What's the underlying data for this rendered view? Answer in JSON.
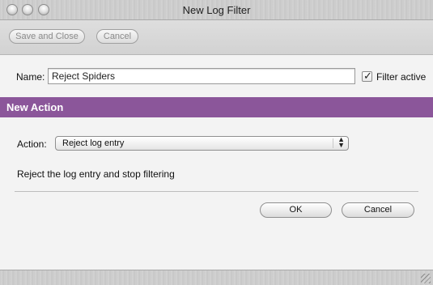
{
  "window": {
    "title": "New Log Filter"
  },
  "toolbar": {
    "save_close_label": "Save and Close",
    "cancel_label": "Cancel"
  },
  "form": {
    "name_label": "Name:",
    "name_value": "Reject Spiders",
    "filter_active_label": "Filter active",
    "filter_active_checked": true
  },
  "section": {
    "title": "New Action"
  },
  "action": {
    "label": "Action:",
    "selected": "Reject log entry",
    "description": "Reject the log entry and stop filtering"
  },
  "buttons": {
    "ok_label": "OK",
    "cancel_label": "Cancel"
  },
  "colors": {
    "section_header": "#8b569a"
  }
}
